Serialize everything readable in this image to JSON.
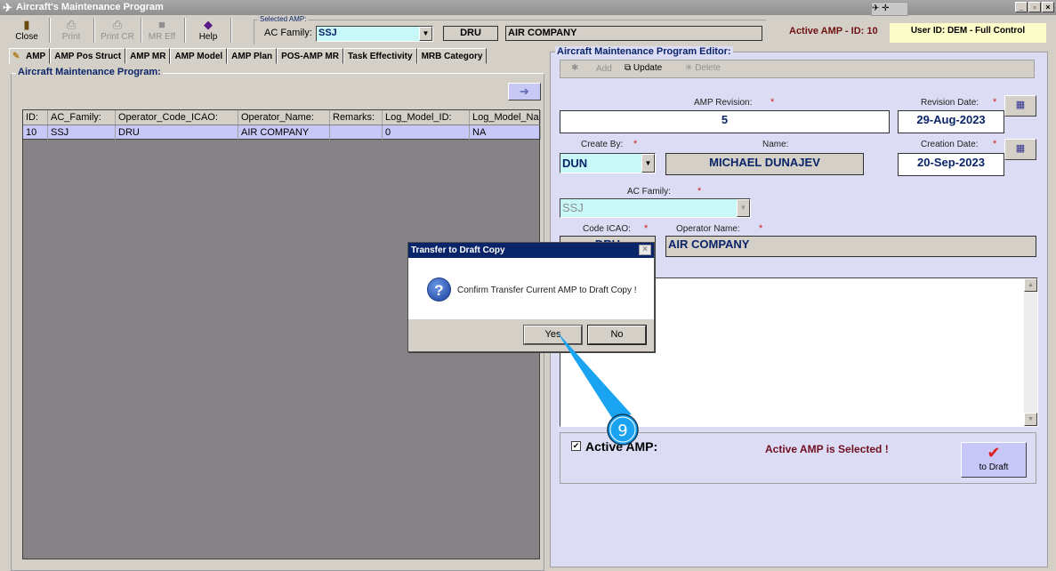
{
  "window": {
    "title": "Aircraft's Maintenance Program"
  },
  "toolbar": {
    "close": "Close",
    "print": "Print",
    "print_cr": "Print CR",
    "mr_eff": "MR Eff",
    "help": "Help"
  },
  "selected_amp": {
    "group_label": "Selected AMP:",
    "ac_family_label": "AC Family:",
    "ac_family_value": "SSJ",
    "operator_code": "DRU",
    "operator_name": "AIR COMPANY"
  },
  "status": {
    "active_amp": "Active AMP - ID: 10",
    "user": "User ID: DEM - Full Control"
  },
  "tabs": [
    {
      "label": "AMP"
    },
    {
      "label": "AMP Pos Struct"
    },
    {
      "label": "AMP MR"
    },
    {
      "label": "AMP Model"
    },
    {
      "label": "AMP Plan"
    },
    {
      "label": "POS-AMP MR"
    },
    {
      "label": "Task Effectivity"
    },
    {
      "label": "MRB Category"
    }
  ],
  "left_panel": {
    "title": "Aircraft Maintenance Program:",
    "columns": [
      "ID:",
      "AC_Family:",
      "Operator_Code_ICAO:",
      "Operator_Name:",
      "Remarks:",
      "Log_Model_ID:",
      "Log_Model_Na"
    ],
    "rows": [
      [
        "10",
        "SSJ",
        "DRU",
        "AIR COMPANY",
        "",
        "0",
        "NA"
      ]
    ]
  },
  "editor": {
    "title": "Aircraft Maintenance Program Editor:",
    "toolbar": {
      "add": "Add",
      "update": "Update",
      "delete": "Delete"
    },
    "amp_revision_label": "AMP Revision:",
    "amp_revision": "5",
    "revision_date_label": "Revision Date:",
    "revision_date": "29-Aug-2023",
    "create_by_label": "Create By:",
    "create_by": "DUN",
    "name_label": "Name:",
    "name": "MICHAEL DUNAJEV",
    "creation_date_label": "Creation Date:",
    "creation_date": "20-Sep-2023",
    "ac_family_label": "AC Family:",
    "ac_family": "SSJ",
    "code_icao_label": "Code ICAO:",
    "code_icao": "DRU",
    "operator_name_label": "Operator Name:",
    "operator_name": "AIR COMPANY",
    "required_mark": "*",
    "active_amp_label": "Active AMP:",
    "active_amp_checked": true,
    "active_msg": "Active AMP is Selected !",
    "to_draft": "to Draft"
  },
  "dialog": {
    "title": "Transfer to Draft Copy",
    "message": "Confirm Transfer Current AMP to Draft Copy !",
    "yes": "Yes",
    "no": "No"
  },
  "annotation": {
    "step": "9",
    "color": "#1aa3f0"
  }
}
